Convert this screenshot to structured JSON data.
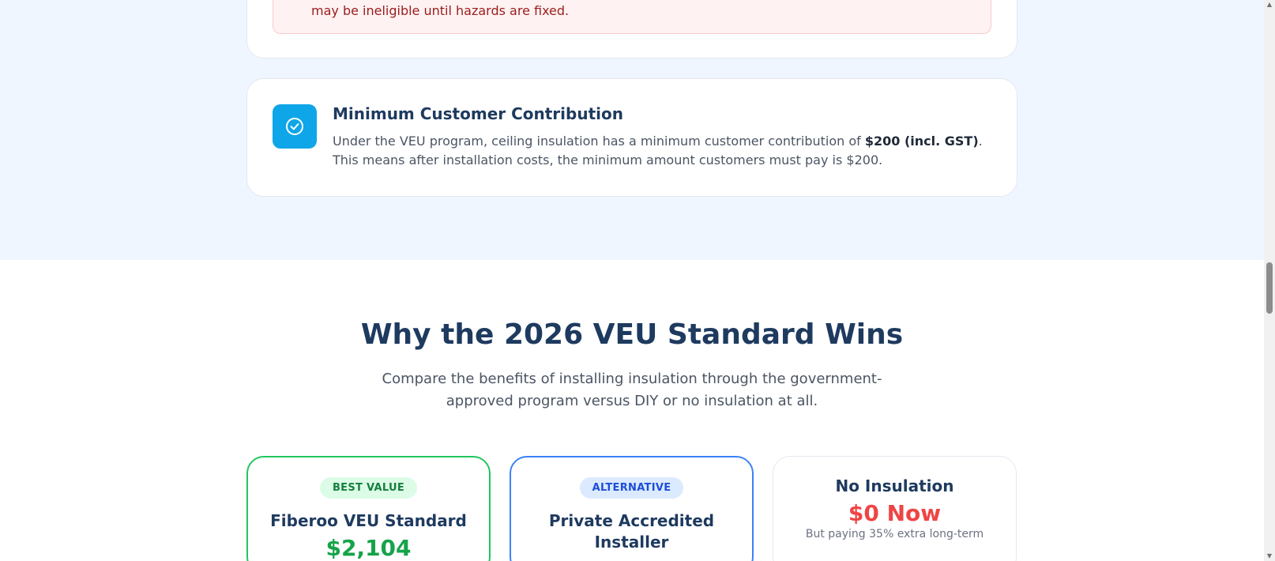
{
  "alert": {
    "text": "may be ineligible until hazards are fixed."
  },
  "info": {
    "icon": "check-circle-icon",
    "title": "Minimum Customer Contribution",
    "body_prefix": "Under the VEU program, ceiling insulation has a minimum customer contribution of ",
    "body_bold": "$200 (incl. GST)",
    "body_suffix": ". This means after installation costs, the minimum amount customers must pay is $200."
  },
  "section": {
    "title": "Why the 2026 VEU Standard Wins",
    "subtitle": "Compare the benefits of installing insulation through the government-approved program versus DIY or no insulation at all."
  },
  "plans": [
    {
      "badge": "BEST VALUE",
      "name": "Fiberoo VEU Standard",
      "price": "$2,104"
    },
    {
      "badge": "ALTERNATIVE",
      "name": "Private Accredited Installer"
    },
    {
      "name": "No Insulation",
      "price": "$0 Now",
      "note": "But paying 35% extra long-term"
    }
  ],
  "colors": {
    "accent_green": "#16a34a",
    "accent_blue": "#1d4ed8",
    "accent_red": "#ef4444",
    "icon_bg": "#0ea5e9",
    "heading": "#1e3a5f"
  }
}
